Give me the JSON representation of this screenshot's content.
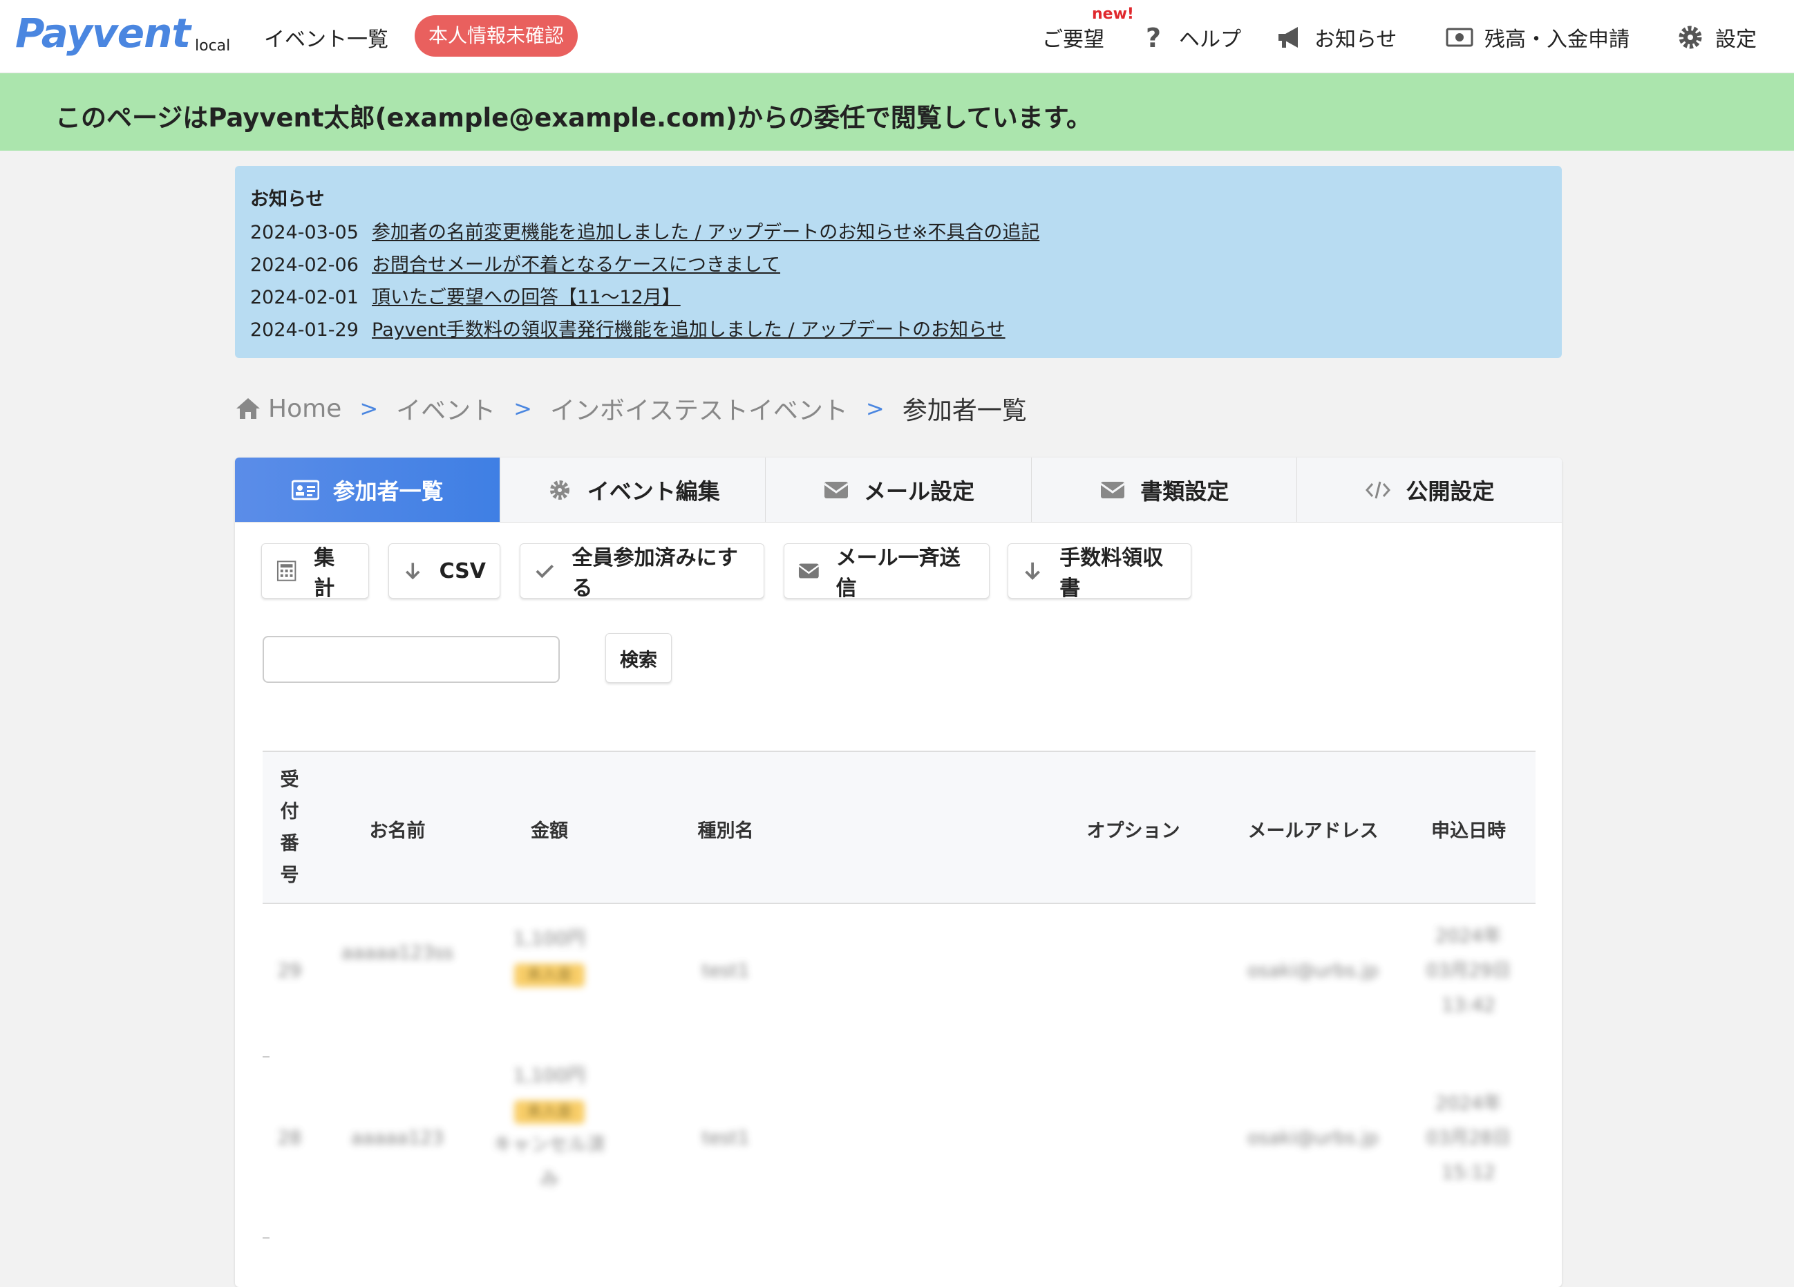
{
  "header": {
    "logo": "Payvent",
    "logo_sub": "local",
    "events_link": "イベント一覧",
    "unverified_badge": "本人情報未確認",
    "new_mark": "new!",
    "nav": {
      "request": "ご要望",
      "help": "ヘルプ",
      "news": "お知らせ",
      "balance": "残高・入金申請",
      "settings": "設定"
    }
  },
  "delegation": {
    "message": "このページはPayvent太郎(example@example.com)からの委任で閲覧しています。"
  },
  "notices": {
    "title": "お知らせ",
    "items": [
      {
        "date": "2024-03-05",
        "text": "参加者の名前変更機能を追加しました / アップデートのお知らせ※不具合の追記"
      },
      {
        "date": "2024-02-06",
        "text": "お問合せメールが不着となるケースにつきまして"
      },
      {
        "date": "2024-02-01",
        "text": "頂いたご要望への回答【11〜12月】"
      },
      {
        "date": "2024-01-29",
        "text": "Payvent手数料の領収書発行機能を追加しました / アップデートのお知らせ"
      }
    ]
  },
  "breadcrumb": {
    "home": "Home",
    "events": "イベント",
    "event": "インボイステストイベント",
    "current": "参加者一覧",
    "sep": ">"
  },
  "tabs": {
    "participants": "参加者一覧",
    "edit": "イベント編集",
    "mail": "メール設定",
    "docs": "書類設定",
    "publish": "公開設定"
  },
  "actions": {
    "summary": "集計",
    "csv": "CSV",
    "mark_all": "全員参加済みにする",
    "mail_all": "メール一斉送信",
    "receipt": "手数料領収書"
  },
  "search": {
    "button": "検索",
    "value": ""
  },
  "table": {
    "headers": {
      "receipt_no": [
        "受",
        "付",
        "番",
        "号"
      ],
      "name": "お名前",
      "amount": "金額",
      "ticket_type": "種別名",
      "option": "オプション",
      "email": "メールアドレス",
      "applied_at": "申込日時"
    },
    "rows": [
      {
        "no": "29",
        "name": "aaaaa123ss",
        "amount": "1,100円",
        "status": "未入金",
        "sub": "",
        "sub2": "",
        "type": "test1",
        "email": "osaki@urbs.jp",
        "date1": "2024年",
        "date2": "03月29日",
        "date3": "13:42"
      },
      {
        "no": "28",
        "name": "aaaaa123",
        "amount": "1,100円",
        "status": "未入金",
        "sub": "キャンセル済",
        "sub2": "み",
        "type": "test1",
        "email": "osaki@urbs.jp",
        "date1": "2024年",
        "date2": "03月28日",
        "date3": "15:12"
      }
    ]
  }
}
